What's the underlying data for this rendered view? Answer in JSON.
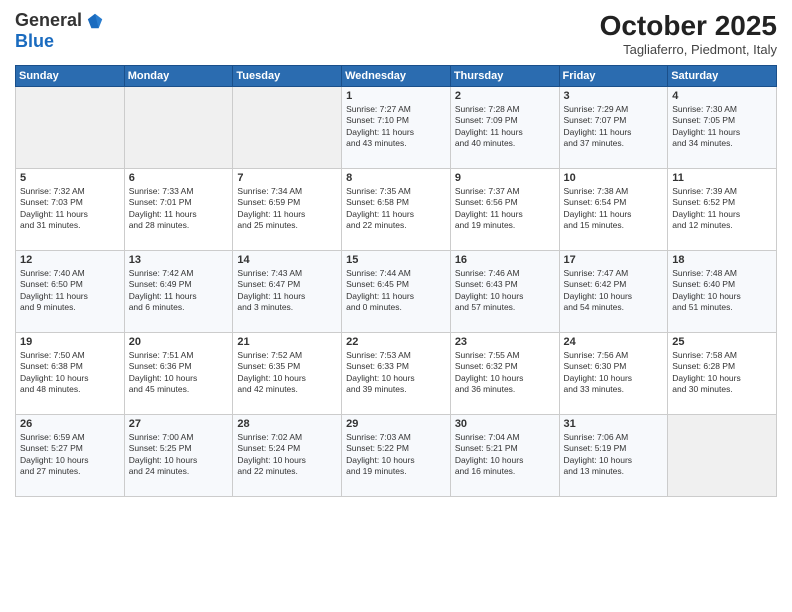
{
  "logo": {
    "general": "General",
    "blue": "Blue"
  },
  "header": {
    "month": "October 2025",
    "location": "Tagliaferro, Piedmont, Italy"
  },
  "weekdays": [
    "Sunday",
    "Monday",
    "Tuesday",
    "Wednesday",
    "Thursday",
    "Friday",
    "Saturday"
  ],
  "weeks": [
    [
      {
        "day": "",
        "info": ""
      },
      {
        "day": "",
        "info": ""
      },
      {
        "day": "",
        "info": ""
      },
      {
        "day": "1",
        "info": "Sunrise: 7:27 AM\nSunset: 7:10 PM\nDaylight: 11 hours\nand 43 minutes."
      },
      {
        "day": "2",
        "info": "Sunrise: 7:28 AM\nSunset: 7:09 PM\nDaylight: 11 hours\nand 40 minutes."
      },
      {
        "day": "3",
        "info": "Sunrise: 7:29 AM\nSunset: 7:07 PM\nDaylight: 11 hours\nand 37 minutes."
      },
      {
        "day": "4",
        "info": "Sunrise: 7:30 AM\nSunset: 7:05 PM\nDaylight: 11 hours\nand 34 minutes."
      }
    ],
    [
      {
        "day": "5",
        "info": "Sunrise: 7:32 AM\nSunset: 7:03 PM\nDaylight: 11 hours\nand 31 minutes."
      },
      {
        "day": "6",
        "info": "Sunrise: 7:33 AM\nSunset: 7:01 PM\nDaylight: 11 hours\nand 28 minutes."
      },
      {
        "day": "7",
        "info": "Sunrise: 7:34 AM\nSunset: 6:59 PM\nDaylight: 11 hours\nand 25 minutes."
      },
      {
        "day": "8",
        "info": "Sunrise: 7:35 AM\nSunset: 6:58 PM\nDaylight: 11 hours\nand 22 minutes."
      },
      {
        "day": "9",
        "info": "Sunrise: 7:37 AM\nSunset: 6:56 PM\nDaylight: 11 hours\nand 19 minutes."
      },
      {
        "day": "10",
        "info": "Sunrise: 7:38 AM\nSunset: 6:54 PM\nDaylight: 11 hours\nand 15 minutes."
      },
      {
        "day": "11",
        "info": "Sunrise: 7:39 AM\nSunset: 6:52 PM\nDaylight: 11 hours\nand 12 minutes."
      }
    ],
    [
      {
        "day": "12",
        "info": "Sunrise: 7:40 AM\nSunset: 6:50 PM\nDaylight: 11 hours\nand 9 minutes."
      },
      {
        "day": "13",
        "info": "Sunrise: 7:42 AM\nSunset: 6:49 PM\nDaylight: 11 hours\nand 6 minutes."
      },
      {
        "day": "14",
        "info": "Sunrise: 7:43 AM\nSunset: 6:47 PM\nDaylight: 11 hours\nand 3 minutes."
      },
      {
        "day": "15",
        "info": "Sunrise: 7:44 AM\nSunset: 6:45 PM\nDaylight: 11 hours\nand 0 minutes."
      },
      {
        "day": "16",
        "info": "Sunrise: 7:46 AM\nSunset: 6:43 PM\nDaylight: 10 hours\nand 57 minutes."
      },
      {
        "day": "17",
        "info": "Sunrise: 7:47 AM\nSunset: 6:42 PM\nDaylight: 10 hours\nand 54 minutes."
      },
      {
        "day": "18",
        "info": "Sunrise: 7:48 AM\nSunset: 6:40 PM\nDaylight: 10 hours\nand 51 minutes."
      }
    ],
    [
      {
        "day": "19",
        "info": "Sunrise: 7:50 AM\nSunset: 6:38 PM\nDaylight: 10 hours\nand 48 minutes."
      },
      {
        "day": "20",
        "info": "Sunrise: 7:51 AM\nSunset: 6:36 PM\nDaylight: 10 hours\nand 45 minutes."
      },
      {
        "day": "21",
        "info": "Sunrise: 7:52 AM\nSunset: 6:35 PM\nDaylight: 10 hours\nand 42 minutes."
      },
      {
        "day": "22",
        "info": "Sunrise: 7:53 AM\nSunset: 6:33 PM\nDaylight: 10 hours\nand 39 minutes."
      },
      {
        "day": "23",
        "info": "Sunrise: 7:55 AM\nSunset: 6:32 PM\nDaylight: 10 hours\nand 36 minutes."
      },
      {
        "day": "24",
        "info": "Sunrise: 7:56 AM\nSunset: 6:30 PM\nDaylight: 10 hours\nand 33 minutes."
      },
      {
        "day": "25",
        "info": "Sunrise: 7:58 AM\nSunset: 6:28 PM\nDaylight: 10 hours\nand 30 minutes."
      }
    ],
    [
      {
        "day": "26",
        "info": "Sunrise: 6:59 AM\nSunset: 5:27 PM\nDaylight: 10 hours\nand 27 minutes."
      },
      {
        "day": "27",
        "info": "Sunrise: 7:00 AM\nSunset: 5:25 PM\nDaylight: 10 hours\nand 24 minutes."
      },
      {
        "day": "28",
        "info": "Sunrise: 7:02 AM\nSunset: 5:24 PM\nDaylight: 10 hours\nand 22 minutes."
      },
      {
        "day": "29",
        "info": "Sunrise: 7:03 AM\nSunset: 5:22 PM\nDaylight: 10 hours\nand 19 minutes."
      },
      {
        "day": "30",
        "info": "Sunrise: 7:04 AM\nSunset: 5:21 PM\nDaylight: 10 hours\nand 16 minutes."
      },
      {
        "day": "31",
        "info": "Sunrise: 7:06 AM\nSunset: 5:19 PM\nDaylight: 10 hours\nand 13 minutes."
      },
      {
        "day": "",
        "info": ""
      }
    ]
  ]
}
